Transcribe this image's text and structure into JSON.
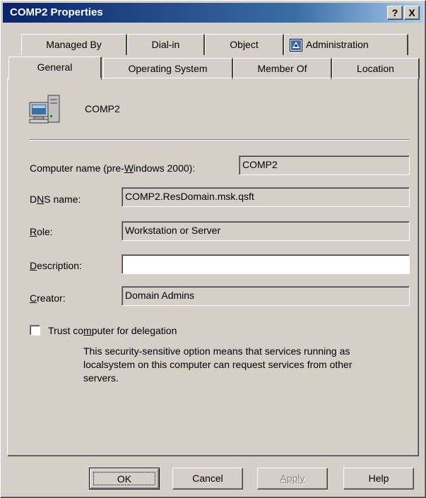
{
  "window": {
    "title": "COMP2 Properties",
    "help_button": "?",
    "close_button": "X"
  },
  "tabs": {
    "row1": [
      {
        "label": "Managed By"
      },
      {
        "label": "Dial-in"
      },
      {
        "label": "Object"
      },
      {
        "label": "Administration",
        "icon": "administration-icon"
      }
    ],
    "row2": [
      {
        "label": "General",
        "selected": true
      },
      {
        "label": "Operating System"
      },
      {
        "label": "Member Of"
      },
      {
        "label": "Location"
      }
    ]
  },
  "general": {
    "computer_icon": "computer-icon",
    "computer_title": "COMP2",
    "computer_name_label_pre": "Computer name (pre-",
    "computer_name_label_accel": "W",
    "computer_name_label_post": "indows 2000):",
    "computer_name_value": "COMP2",
    "dns_label_pre": "D",
    "dns_label_accel": "N",
    "dns_label_post": "S name:",
    "dns_value": "COMP2.ResDomain.msk.qsft",
    "role_label_accel": "R",
    "role_label_post": "ole:",
    "role_value": "Workstation or Server",
    "description_label_accel": "D",
    "description_label_post": "escription:",
    "description_value": "",
    "creator_label_accel": "C",
    "creator_label_post": "reator:",
    "creator_value": "Domain Admins",
    "trust_label_pre": "Trust co",
    "trust_label_accel": "m",
    "trust_label_post": "puter for delegation",
    "trust_checked": false,
    "trust_note": "This security-sensitive option means that services running as localsystem on this computer can request services from other servers."
  },
  "buttons": {
    "ok": "OK",
    "cancel": "Cancel",
    "apply": "Apply",
    "help": "Help"
  },
  "colors": {
    "dialog_bg": "#d4d0c8",
    "title_bar": "#0a246a",
    "title_text": "#ffffff"
  }
}
